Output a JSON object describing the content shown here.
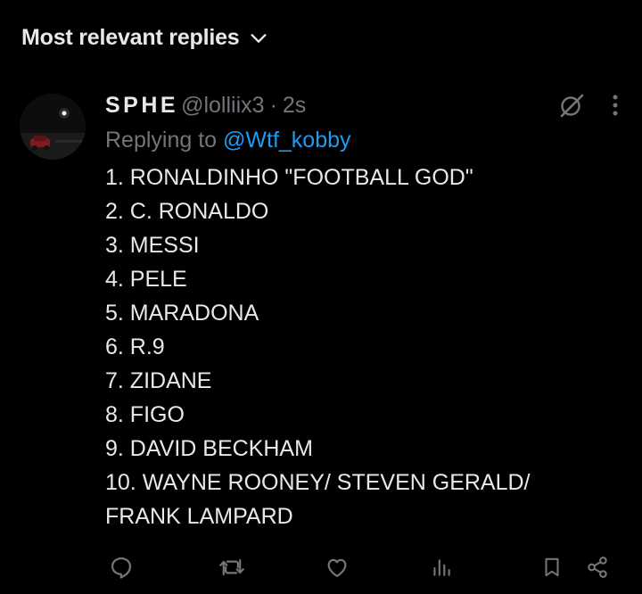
{
  "sort": {
    "label": "Most relevant replies",
    "chevron_icon": "chevron-down-icon"
  },
  "reply": {
    "avatar_icon": "profile-avatar",
    "display_name": "SPHE",
    "handle": "@lolliix3",
    "separator": "·",
    "time": "2s",
    "replying_prefix": "Replying to ",
    "replying_to": "@Wtf_kobby",
    "lines": [
      "1. RONALDINHO \"FOOTBALL GOD\"",
      "2. C. RONALDO",
      "3. MESSI",
      "4. PELE",
      "5. MARADONA",
      "6. R.9",
      "7. ZIDANE",
      "8. FIGO",
      "9. DAVID BECKHAM",
      "10. WAYNE ROONEY/ STEVEN GERALD/",
      "FRANK LAMPARD"
    ],
    "top_icons": [
      "grok-icon",
      "more-icon"
    ],
    "actions": [
      "reply-icon",
      "repost-icon",
      "like-icon",
      "views-icon",
      "bookmark-icon",
      "share-icon"
    ]
  },
  "colors": {
    "background": "#000000",
    "primary_text": "#e7e9ea",
    "secondary_text": "#71767b",
    "link": "#1d9bf0"
  }
}
